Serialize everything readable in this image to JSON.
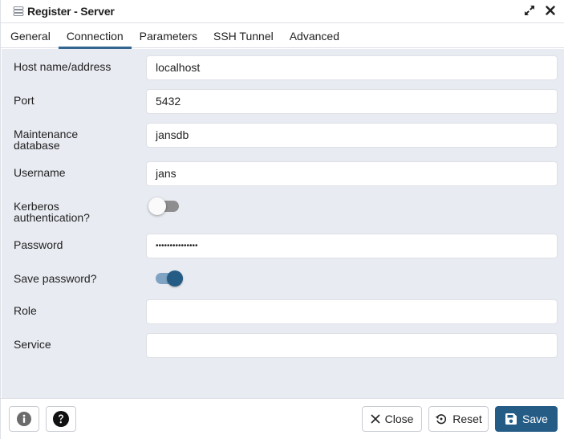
{
  "window": {
    "title": "Register - Server",
    "icon": "server-icon",
    "controls": [
      {
        "name": "maximize",
        "icon": "expand-icon"
      },
      {
        "name": "close",
        "icon": "close-icon"
      }
    ]
  },
  "tabs": [
    {
      "label": "General",
      "active": false
    },
    {
      "label": "Connection",
      "active": true
    },
    {
      "label": "Parameters",
      "active": false
    },
    {
      "label": "SSH Tunnel",
      "active": false
    },
    {
      "label": "Advanced",
      "active": false
    }
  ],
  "form": {
    "host": {
      "label": "Host name/address",
      "value": "localhost"
    },
    "port": {
      "label": "Port",
      "value": "5432"
    },
    "maintenance_db": {
      "label_line1": "Maintenance",
      "label_line2": "database",
      "value": "jansdb"
    },
    "username": {
      "label": "Username",
      "value": "jans"
    },
    "kerberos": {
      "label_line1": "Kerberos",
      "label_line2": "authentication?",
      "checked": false
    },
    "password": {
      "label": "Password",
      "value": "•••••••••••••••"
    },
    "save_password": {
      "label": "Save password?",
      "checked": true
    },
    "role": {
      "label": "Role",
      "value": ""
    },
    "service": {
      "label": "Service",
      "value": ""
    }
  },
  "footer": {
    "info_icon": "info-icon",
    "help_icon": "help-icon",
    "close_label": "Close",
    "reset_label": "Reset",
    "save_label": "Save"
  },
  "colors": {
    "accent": "#245c86",
    "tab_underline": "#326690",
    "form_bg": "#e8ebf2"
  }
}
